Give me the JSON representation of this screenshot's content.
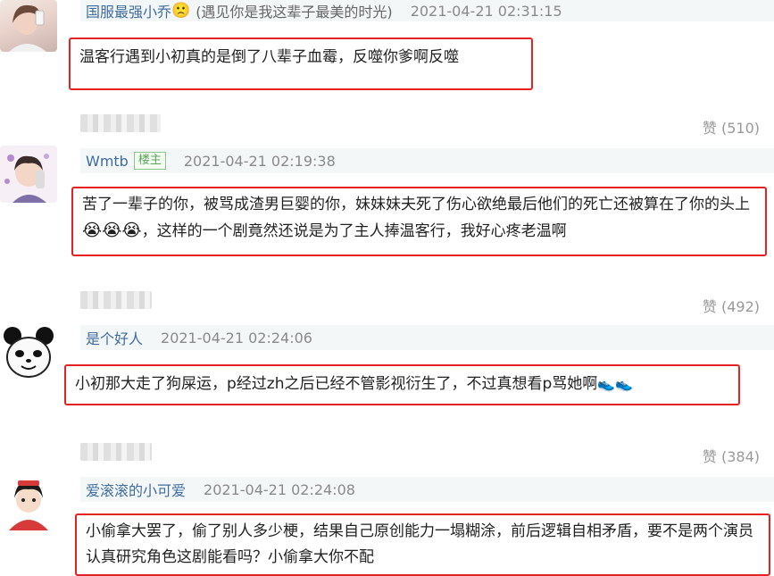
{
  "comments": [
    {
      "username": "国服最强小乔",
      "emoji": "🙁",
      "signature": "(遇见你是我这辈子最美的时光)",
      "timestamp": "2021-04-21 02:31:15",
      "content": "温客行遇到小初真的是倒了八辈子血霉，反噬你爹啊反噬",
      "likes": "赞 (510)"
    },
    {
      "username": "Wmtb",
      "badge": "楼主",
      "timestamp": "2021-04-21 02:19:38",
      "content": "苦了一辈子的你，被骂成渣男巨婴的你，妹妹妹夫死了伤心欲绝最后他们的死亡还被算在了你的头上",
      "content_emoji": "😭😭😭",
      "content_tail": "，这样的一个剧竟然还说是为了主人捧温客行，我好心疼老温啊",
      "likes": "赞 (492)"
    },
    {
      "username": "是个好人",
      "timestamp": "2021-04-21 02:24:06",
      "content": "小初那大走了狗屎运，p经过zh之后已经不管影视衍生了，不过真想看p骂她啊",
      "content_emoji": "👟👟",
      "likes": "赞 (384)"
    },
    {
      "username": "爱滚滚的小可爱",
      "timestamp": "2021-04-21 02:24:08",
      "content": "小偷拿大罢了，偷了别人多少梗，结果自己原创能力一塌糊涂，前后逻辑自相矛盾，要不是两个演员认真研究角色这剧能看吗？小偷拿大你不配"
    }
  ],
  "colors": {
    "highlight_border": "#e42222",
    "username": "#3f6c9e",
    "meta_bg": "#f4f7f8"
  }
}
